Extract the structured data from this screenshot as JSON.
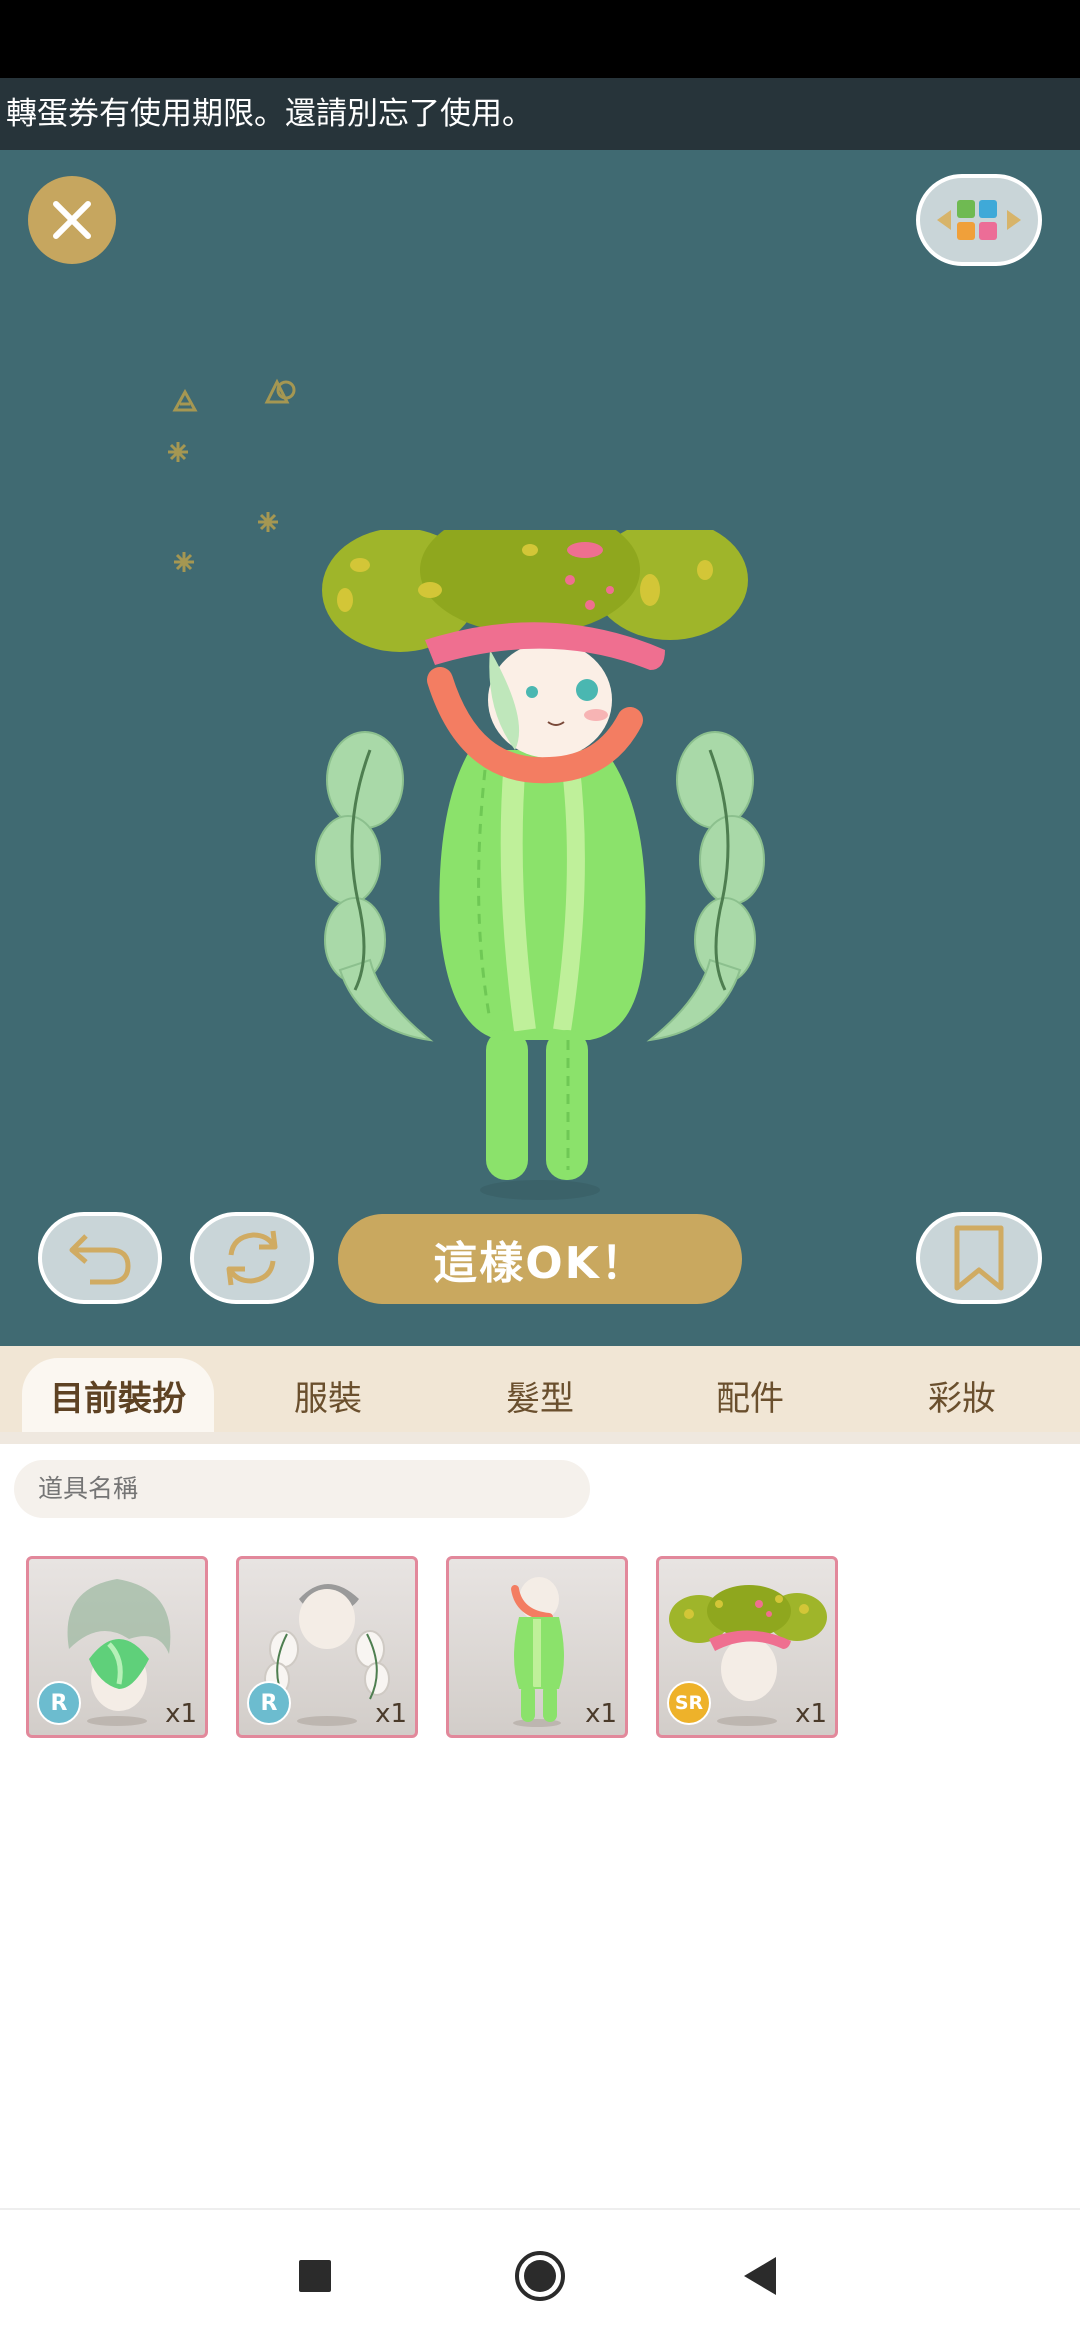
{
  "notice": {
    "text": "轉蛋券有使用期限。還請別忘了使用。"
  },
  "stage": {
    "confirm_label": "這樣OK！",
    "icons": {
      "close": "close-icon",
      "layout": "color-grid-icon",
      "undo": "undo-arrow-icon",
      "refresh": "refresh-icon",
      "bookmark": "bookmark-icon"
    }
  },
  "tabs": [
    {
      "label": "目前裝扮",
      "active": true
    },
    {
      "label": "服裝",
      "active": false
    },
    {
      "label": "髮型",
      "active": false
    },
    {
      "label": "配件",
      "active": false
    },
    {
      "label": "彩妝",
      "active": false
    }
  ],
  "search": {
    "placeholder": "道具名稱"
  },
  "items": [
    {
      "rarity": "R",
      "qty": "x1"
    },
    {
      "rarity": "R",
      "qty": "x1"
    },
    {
      "rarity": "",
      "qty": "x1"
    },
    {
      "rarity": "SR",
      "qty": "x1"
    }
  ],
  "colors": {
    "stage_bg": "#406a72",
    "accent_gold": "#c9a85f",
    "tab_bg": "#f1e6d5",
    "item_border": "#e2889b",
    "rarity_r": "#6cbccf",
    "rarity_sr": "#eeb22a"
  },
  "navbar": {
    "icons": [
      "recents-square-icon",
      "home-circle-icon",
      "back-triangle-icon"
    ]
  }
}
